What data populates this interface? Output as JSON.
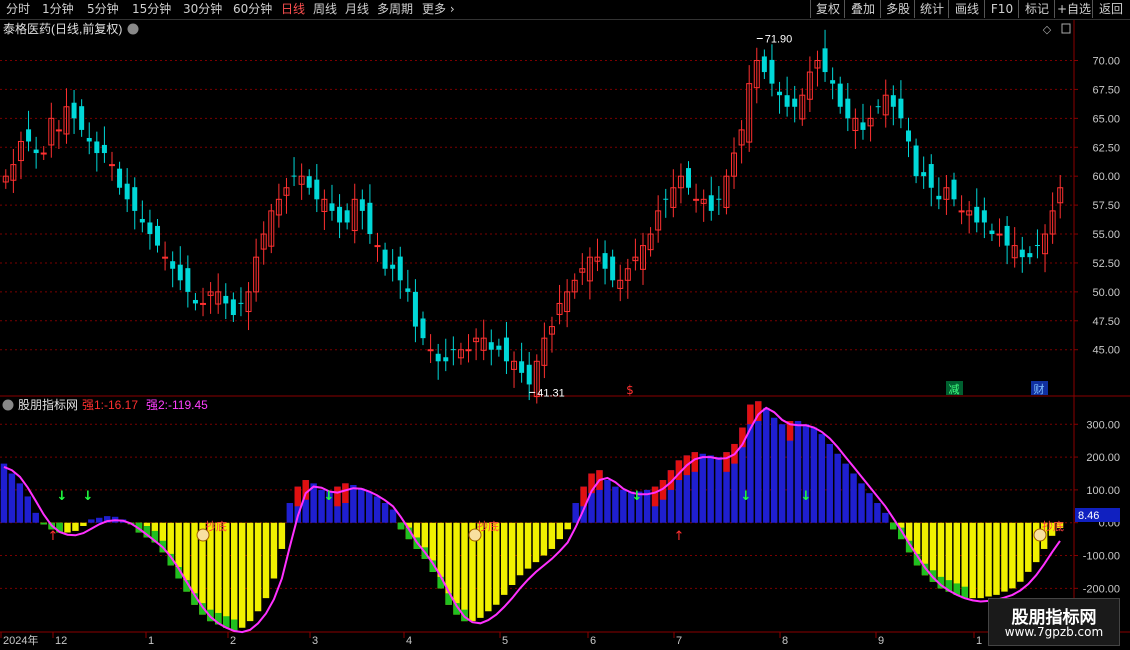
{
  "toolbar": {
    "periods": [
      "分时",
      "1分钟",
      "5分钟",
      "15分钟",
      "30分钟",
      "60分钟",
      "日线",
      "周线",
      "月线",
      "多周期",
      "更多"
    ],
    "active_period": "日线",
    "right_buttons": [
      "复权",
      "叠加",
      "多股",
      "统计",
      "画线",
      "F10",
      "标记",
      "+自选",
      "返回"
    ]
  },
  "chart_data": [
    {
      "type": "candlestick",
      "title": "泰格医药(日线,前复权)",
      "y_ticks": [
        "70.00",
        "67.50",
        "65.00",
        "62.50",
        "60.00",
        "57.50",
        "55.00",
        "52.50",
        "50.00",
        "47.50",
        "45.00"
      ],
      "ylim": [
        41.0,
        73.5
      ],
      "annotations": {
        "high": "71.90",
        "low": "41.31"
      },
      "markers": [
        "$",
        "减",
        "财"
      ],
      "close_approx": [
        60,
        61,
        63,
        63,
        62,
        62,
        65,
        64,
        66,
        65,
        64,
        63,
        62,
        62,
        61,
        59,
        58,
        57,
        56,
        55,
        54,
        53,
        52,
        51,
        50,
        49,
        49,
        50,
        50,
        49,
        48,
        49,
        50,
        53,
        55,
        57,
        58,
        59,
        60,
        60,
        59,
        58,
        58,
        57,
        56,
        56,
        58,
        57,
        55,
        54,
        52,
        52,
        51,
        50,
        47,
        46,
        45,
        44,
        44,
        45,
        45,
        45,
        46,
        46,
        45,
        45,
        44,
        44,
        43,
        42,
        44,
        46,
        47,
        49,
        50,
        51,
        52,
        53,
        53,
        52,
        51,
        51,
        52,
        53,
        54,
        55,
        57,
        58,
        59,
        60,
        59,
        58,
        58,
        57,
        58,
        60,
        62,
        64,
        68,
        70,
        69,
        68,
        67,
        66,
        66,
        67,
        69,
        70,
        69,
        68,
        66,
        65,
        65,
        64,
        65,
        66,
        67,
        66,
        65,
        63,
        60,
        60,
        59,
        58,
        59,
        58,
        57,
        57,
        56,
        56,
        55,
        55,
        54,
        54,
        53,
        53,
        54,
        55,
        57,
        59
      ]
    },
    {
      "type": "histogram",
      "name": "股朋指标网",
      "series": [
        {
          "name": "强1",
          "last": "-16.17"
        },
        {
          "name": "强2",
          "last": "-119.45"
        }
      ],
      "y_ticks": [
        "300.00",
        "200.00",
        "100.00",
        "0.00",
        "-100.00",
        "-200.00"
      ],
      "ylim": [
        -330,
        380
      ],
      "current_value": "8.46",
      "labels": [
        "抄底",
        "抄底",
        "抄底"
      ],
      "values_approx": [
        180,
        150,
        120,
        80,
        30,
        -5,
        -20,
        -30,
        -30,
        -25,
        -10,
        10,
        15,
        20,
        18,
        10,
        -5,
        -30,
        -45,
        -60,
        -90,
        -130,
        -170,
        -210,
        -250,
        -280,
        -300,
        -310,
        -320,
        -330,
        -320,
        -300,
        -270,
        -230,
        -170,
        -80,
        60,
        110,
        130,
        120,
        100,
        95,
        110,
        120,
        115,
        105,
        95,
        80,
        60,
        40,
        -20,
        -50,
        -80,
        -110,
        -150,
        -200,
        -250,
        -280,
        -300,
        -300,
        -290,
        -270,
        -250,
        -220,
        -190,
        -160,
        -140,
        -120,
        -100,
        -80,
        -50,
        -20,
        60,
        110,
        150,
        160,
        130,
        110,
        100,
        95,
        95,
        100,
        110,
        130,
        160,
        190,
        205,
        215,
        210,
        205,
        200,
        215,
        240,
        290,
        360,
        370,
        350,
        320,
        300,
        310,
        310,
        300,
        290,
        270,
        240,
        210,
        180,
        150,
        120,
        90,
        60,
        30,
        -20,
        -50,
        -90,
        -130,
        -160,
        -180,
        -200,
        -210,
        -220,
        -230,
        -230,
        -230,
        -225,
        -220,
        -210,
        -200,
        -180,
        -150,
        -120,
        -80,
        -40,
        -16
      ]
    }
  ],
  "axis": {
    "dates": [
      "2024年",
      "12",
      "1",
      "2",
      "3",
      "4",
      "5",
      "6",
      "7",
      "8",
      "9",
      "1"
    ]
  },
  "watermark": {
    "title": "股朋指标网",
    "url": "www.7gpzb.com"
  },
  "colors": {
    "up": "#ff3030",
    "down": "#00d8d8",
    "hist_pos": "#1f1fd0",
    "hist_neg": "#f0f000",
    "hist_green": "#20c020",
    "hist_red": "#e01010",
    "line": "#ff30ff",
    "grid": "#7a0000"
  }
}
